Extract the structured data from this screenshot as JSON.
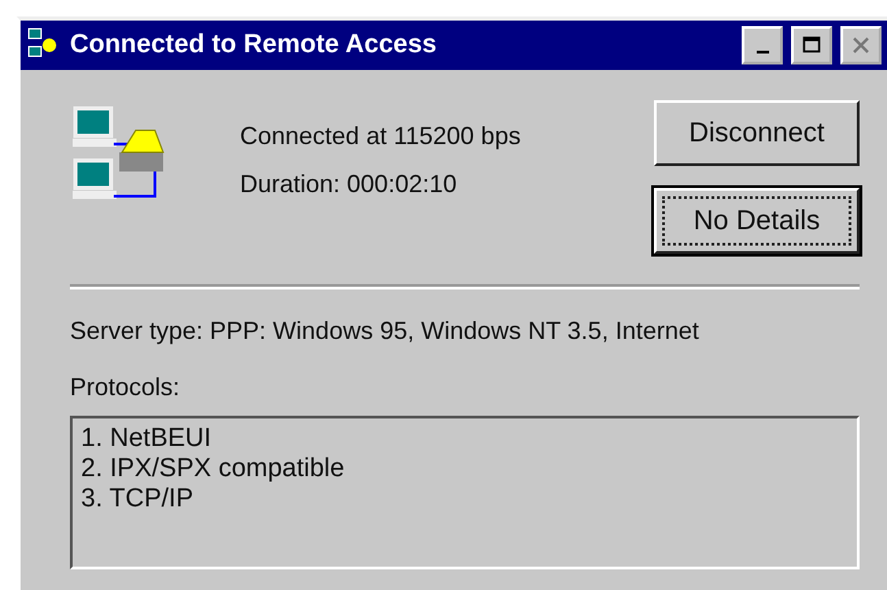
{
  "window": {
    "title": "Connected to Remote Access"
  },
  "status": {
    "speed": "Connected at 115200 bps",
    "duration": "Duration: 000:02:10"
  },
  "buttons": [
    {
      "label": "Disconnect",
      "focused": false
    },
    {
      "label": "No Details",
      "focused": true
    }
  ],
  "server_type": "Server type:    PPP: Windows 95, Windows NT 3.5, Internet",
  "protocols": {
    "label": "Protocols:",
    "items": [
      "1. NetBEUI",
      "2. IPX/SPX compatible",
      "3. TCP/IP"
    ]
  }
}
